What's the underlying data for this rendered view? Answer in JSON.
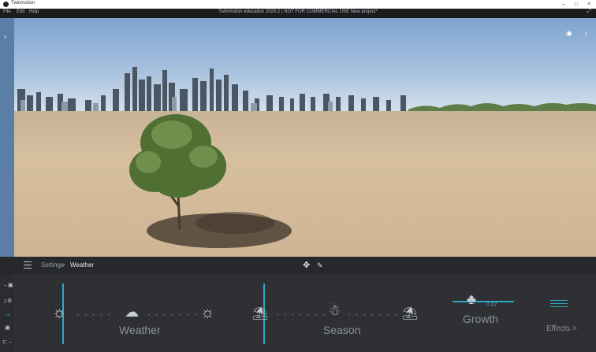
{
  "os_titlebar": {
    "app_title": "Twinmotion",
    "controls": [
      "–",
      "□",
      "×"
    ]
  },
  "menubar": {
    "items": [
      "File",
      "Edit",
      "Help"
    ],
    "center_title": "Twinmotion education 2020.2 | NOT FOR COMMERCIAL USE   New project*"
  },
  "breadcrumb": {
    "settings": "Settings",
    "separator": ">",
    "current": "Weather"
  },
  "sliders": {
    "weather_label": "Weather",
    "season_label": "Season",
    "growth_label": "Growth",
    "growth_value": "0.67",
    "effects_label": "Effects >"
  },
  "colors": {
    "accent": "#2fa8c8",
    "panel": "#2e3033",
    "menubar": "#1b1c1e"
  },
  "icons": {
    "sun": "sun-icon",
    "cloud_sun": "cloud-sun-icon",
    "beach_umbrella": "beach-umbrella-icon",
    "snowman": "snowman-icon",
    "tree": "tree-icon",
    "effects": "sliders-icon"
  }
}
